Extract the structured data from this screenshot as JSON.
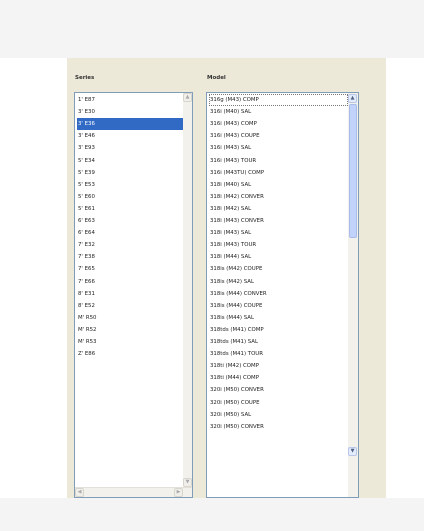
{
  "series": {
    "heading": "Series",
    "items": [
      "1' E87",
      "3' E30",
      "3' E36",
      "3' E46",
      "3' E93",
      "5' E34",
      "5' E39",
      "5' E53",
      "5' E60",
      "5' E61",
      "6' E63",
      "6' E64",
      "7' E32",
      "7' E38",
      "7' E65",
      "7' E66",
      "8' E31",
      "8' E52",
      "M' R50",
      "M' R52",
      "M' R53",
      "Z' E86"
    ],
    "selected_index": 2
  },
  "model": {
    "heading": "Model",
    "items": [
      "316g (M43) COMP",
      "316i (M40) SAL",
      "316i (M43) COMP",
      "316i (M43) COUPE",
      "316i (M43) SAL",
      "316i (M43) TOUR",
      "316i (M43TU) COMP",
      "318i (M40) SAL",
      "318i (M42) CONVER",
      "318i (M42) SAL",
      "318i (M43) CONVER",
      "318i (M43) SAL",
      "318i (M43) TOUR",
      "318i (M44) SAL",
      "318is (M42) COUPE",
      "318is (M42) SAL",
      "318is (M44) CONVER",
      "318is (M44) COUPE",
      "318is (M44) SAL",
      "318tds (M41) COMP",
      "318tds (M41) SAL",
      "318tds (M41) TOUR",
      "318ti (M42) COMP",
      "318ti (M44) COMP",
      "320i (M50) CONVER",
      "320i (M50) COUPE",
      "320i (M50) SAL",
      "320i (M50) CONVER"
    ],
    "focused_index": 0
  },
  "icons": {
    "up": "scroll-up-arrow-icon",
    "down": "scroll-down-arrow-icon",
    "left": "scroll-left-arrow-icon",
    "right": "scroll-right-arrow-icon"
  },
  "colors": {
    "selection": "#316ac5",
    "panel": "#ece9d8",
    "border": "#7f9db9"
  }
}
